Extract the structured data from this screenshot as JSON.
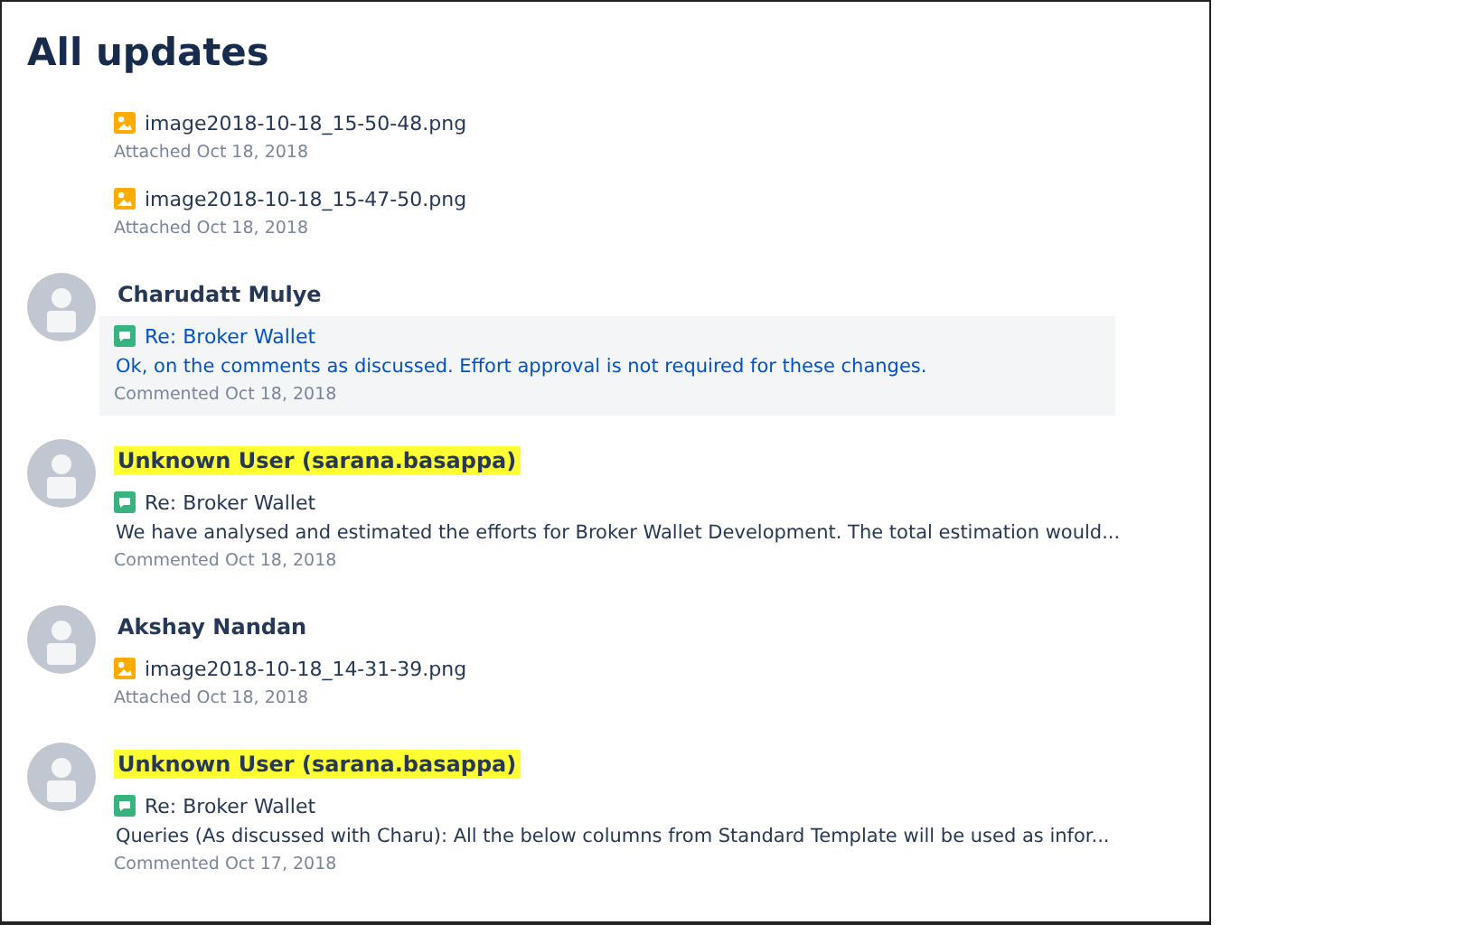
{
  "title": "All updates",
  "groups": [
    {
      "items": [
        {
          "kind": "attachment",
          "title": "image2018-10-18_15-50-48.png",
          "meta": "Attached Oct 18, 2018",
          "selected": false
        },
        {
          "kind": "attachment",
          "title": "image2018-10-18_15-47-50.png",
          "meta": "Attached Oct 18, 2018",
          "selected": false
        }
      ]
    },
    {
      "author": "Charudatt Mulye",
      "highlighted": false,
      "items": [
        {
          "kind": "comment",
          "title": "Re: Broker Wallet",
          "excerpt": "Ok, on the comments as discussed. Effort approval is not required for these changes.",
          "meta": "Commented Oct 18, 2018",
          "selected": true
        }
      ]
    },
    {
      "author": "Unknown User (sarana.basappa)",
      "highlighted": true,
      "items": [
        {
          "kind": "comment",
          "title": "Re: Broker Wallet",
          "excerpt": "We have analysed and estimated the efforts for Broker Wallet Development. The total estimation would...",
          "meta": "Commented Oct 18, 2018",
          "selected": false
        }
      ]
    },
    {
      "author": "Akshay Nandan",
      "highlighted": false,
      "items": [
        {
          "kind": "attachment",
          "title": "image2018-10-18_14-31-39.png",
          "meta": "Attached Oct 18, 2018",
          "selected": false
        }
      ]
    },
    {
      "author": "Unknown User (sarana.basappa)",
      "highlighted": true,
      "items": [
        {
          "kind": "comment",
          "title": "Re: Broker Wallet",
          "excerpt": "Queries (As discussed with Charu): All the below columns from Standard Template will be used as infor...",
          "meta": "Commented Oct 17, 2018",
          "selected": false
        }
      ]
    }
  ]
}
